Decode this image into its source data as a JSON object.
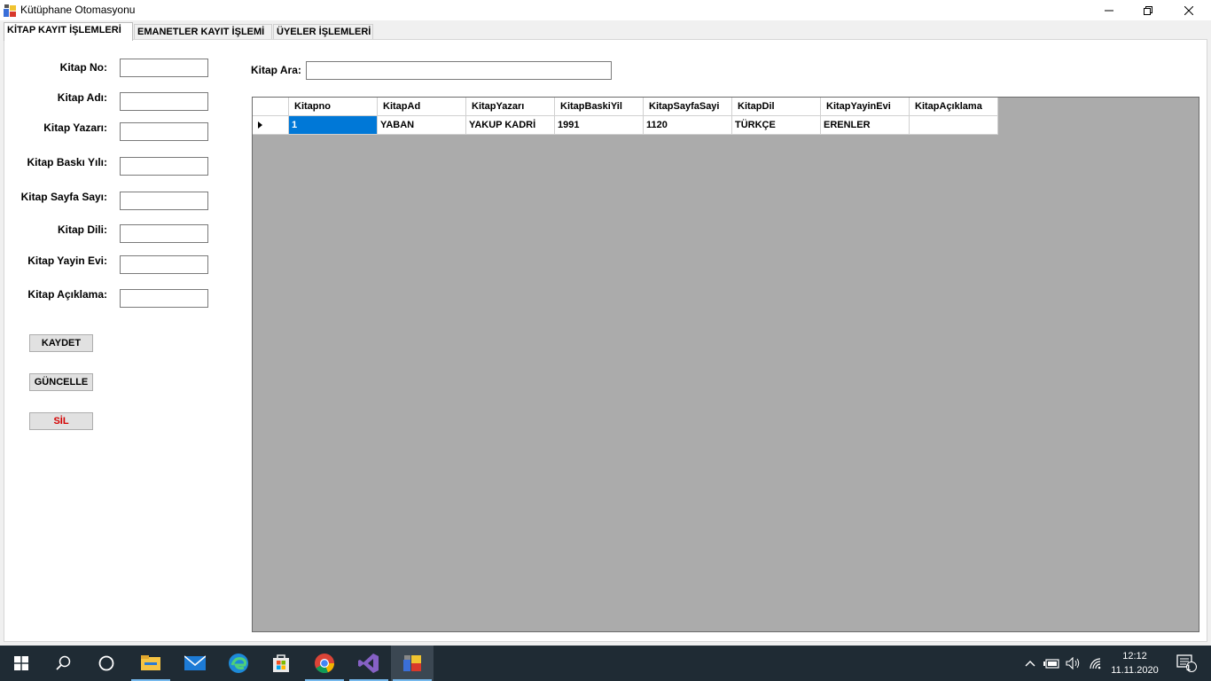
{
  "window": {
    "title": "Kütüphane Otomasyonu"
  },
  "tabs": [
    {
      "label": "KİTAP KAYIT İŞLEMLERİ",
      "active": true
    },
    {
      "label": "EMANETLER KAYIT İŞLEMİ",
      "active": false
    },
    {
      "label": "ÜYELER İŞLEMLERİ",
      "active": false
    }
  ],
  "form": {
    "fields": [
      {
        "label": "Kitap No:",
        "value": ""
      },
      {
        "label": "Kitap Adı:",
        "value": ""
      },
      {
        "label": "Kitap Yazarı:",
        "value": ""
      },
      {
        "label": "Kitap Baskı Yılı:",
        "value": ""
      },
      {
        "label": "Kitap Sayfa Sayı:",
        "value": ""
      },
      {
        "label": "Kitap Dili:",
        "value": ""
      },
      {
        "label": "Kitap Yayin Evi:",
        "value": ""
      },
      {
        "label": "Kitap Açıklama:",
        "value": ""
      }
    ],
    "buttons": {
      "save": "KAYDET",
      "update": "GÜNCELLE",
      "delete": "SİL"
    },
    "delete_color": "#d40000"
  },
  "search": {
    "label": "Kitap Ara:",
    "value": ""
  },
  "table": {
    "columns": [
      "Kitapno",
      "KitapAd",
      "KitapYazarı",
      "KitapBaskiYil",
      "KitapSayfaSayi",
      "KitapDil",
      "KitapYayinEvi",
      "KitapAçıklama"
    ],
    "rows": [
      [
        "1",
        "YABAN",
        "YAKUP KADRİ",
        "1991",
        "1120",
        "TÜRKÇE",
        "ERENLER",
        ""
      ]
    ],
    "selection_color": "#0078d7"
  },
  "taskbar": {
    "items": [
      "start-icon",
      "search-icon",
      "task-view-icon",
      "file-explorer-icon",
      "mail-icon",
      "edge-icon",
      "store-icon",
      "chrome-icon",
      "visual-studio-icon",
      "app-window-icon"
    ],
    "time": "12:12",
    "date": "11.11.2020",
    "notification_count": "1"
  }
}
